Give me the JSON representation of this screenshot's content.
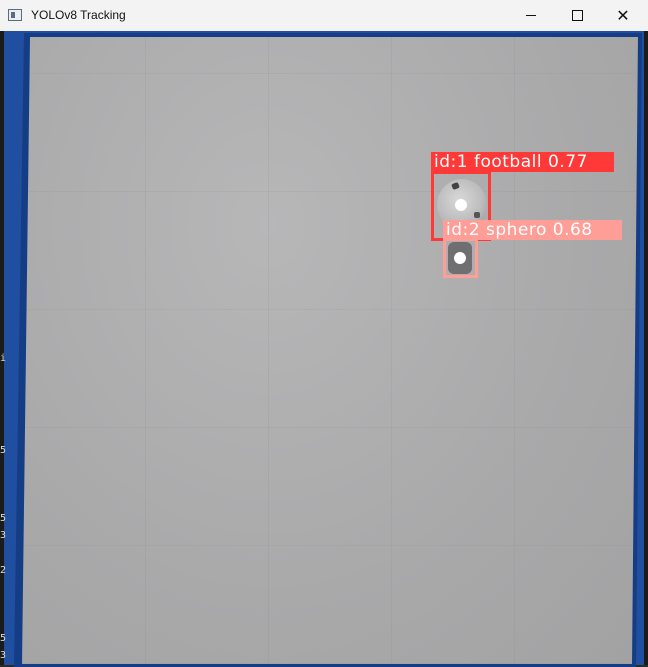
{
  "window": {
    "title": "YOLOv8 Tracking",
    "controls": {
      "minimize": "minimize",
      "maximize": "maximize",
      "close": "✕"
    }
  },
  "side_marks": [
    "i",
    "5",
    "5",
    "3",
    "2",
    "5",
    "3"
  ],
  "detections": [
    {
      "id_label": "id:1",
      "class": "football",
      "confidence": "0.77",
      "text": "id:1 football 0.77",
      "color": "#ff3838"
    },
    {
      "id_label": "id:2",
      "class": "sphero",
      "confidence": "0.68",
      "text": "id:2 sphero 0.68",
      "color": "#ff9d97"
    }
  ],
  "colors": {
    "frame_border": "#1f4f9e",
    "floor": "#a9a9aa",
    "titlebar": "#f3f3f3"
  }
}
